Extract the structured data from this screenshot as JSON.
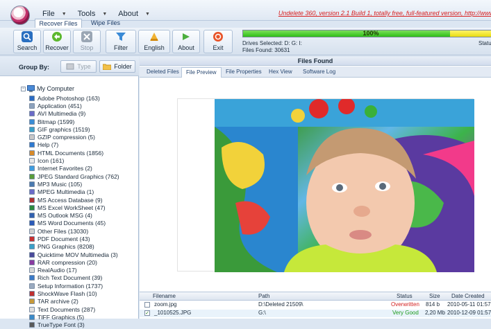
{
  "menu": [
    {
      "label": "File"
    },
    {
      "label": "Tools"
    },
    {
      "label": "About"
    }
  ],
  "promo": "Undelete 360, version 2.1 Build 1, totally free, full-featured version, http://www.",
  "ribbon_tabs": [
    "Recover Files",
    "Wipe Files"
  ],
  "toolbar": {
    "search": "Search",
    "recover": "Recover",
    "stop": "Stop",
    "filter": "Filter",
    "english": "English",
    "about": "About",
    "exit": "Exit"
  },
  "progress": {
    "percent_label": "100%",
    "fraction": 1.0
  },
  "drives_selected": "Drives Selected: D: G: I:",
  "files_found": "Files Found: 30631",
  "status_label": "Statu",
  "group_by": {
    "label": "Group By:",
    "type": "Type",
    "folder": "Folder"
  },
  "tree": {
    "root": "My Computer",
    "items": [
      {
        "label": "Adobe Photoshop (163)",
        "color": "#2b6cc4"
      },
      {
        "label": "Application (451)",
        "color": "#8da2bd"
      },
      {
        "label": "AVI Multimedia (9)",
        "color": "#6b6bc8"
      },
      {
        "label": "Bitmap (1599)",
        "color": "#3a8dd6"
      },
      {
        "label": "GIF graphics (1519)",
        "color": "#3aa0c8"
      },
      {
        "label": "GZIP compression (5)",
        "color": "#c8c8c8"
      },
      {
        "label": "Help (7)",
        "color": "#2f7ad0"
      },
      {
        "label": "HTML Documents (1856)",
        "color": "#d98b2a"
      },
      {
        "label": "Icon (161)",
        "color": "#e8e8e8"
      },
      {
        "label": "Internet Favorites (2)",
        "color": "#3e9de0"
      },
      {
        "label": "JPEG Standard Graphics (762)",
        "color": "#5a9c3a"
      },
      {
        "label": "MP3 Music (105)",
        "color": "#4a7ab0"
      },
      {
        "label": "MPEG Multimedia (1)",
        "color": "#6b6bc8"
      },
      {
        "label": "MS Access Database (9)",
        "color": "#b03030"
      },
      {
        "label": "MS Excel WorkSheet (47)",
        "color": "#2e8b3e"
      },
      {
        "label": "MS Outlook MSG (4)",
        "color": "#3060b0"
      },
      {
        "label": "MS Word Documents (45)",
        "color": "#2a5ab8"
      },
      {
        "label": "Other Files (13030)",
        "color": "#d0d0d0"
      },
      {
        "label": "PDF Document (43)",
        "color": "#c83030"
      },
      {
        "label": "PNG Graphics (8208)",
        "color": "#3aa0c8"
      },
      {
        "label": "Quicktime MOV Multimedia (3)",
        "color": "#4a4a9a"
      },
      {
        "label": "RAR compression (20)",
        "color": "#8a3aa0"
      },
      {
        "label": "RealAudio (17)",
        "color": "#d8d8d8"
      },
      {
        "label": "Rich Text Document (39)",
        "color": "#3a7ac8"
      },
      {
        "label": "Setup Information (1737)",
        "color": "#9aaac0"
      },
      {
        "label": "ShockWave Flash (10)",
        "color": "#c03030"
      },
      {
        "label": "TAR archive (2)",
        "color": "#c89a3a"
      },
      {
        "label": "Text Documents (287)",
        "color": "#e0e0e0"
      },
      {
        "label": "TIFF Graphics (5)",
        "color": "#3a8ac8"
      },
      {
        "label": "TrueType Font (3)",
        "color": "#5a5a5a"
      }
    ]
  },
  "right": {
    "header": "Files Found",
    "tabs": [
      "Deleted Files",
      "File Preview",
      "File Properties",
      "Hex View",
      "Software Log"
    ]
  },
  "filelist": {
    "columns": [
      "Filename",
      "Path",
      "Status",
      "Size",
      "Date Created"
    ],
    "rows": [
      {
        "filename": "zoom.jpg",
        "path": "D:\\Deleted 21509\\",
        "status": "Overwritten",
        "status_color": "#d21c1c",
        "size": "814 b",
        "date": "2010-05-11 01:57",
        "checked": false
      },
      {
        "filename": "_1010525.JPG",
        "path": "G:\\",
        "status": "Very Good",
        "status_color": "#1a9a1a",
        "size": "2,20 Mb",
        "date": "2010-12-09 01:57",
        "checked": true
      }
    ]
  }
}
